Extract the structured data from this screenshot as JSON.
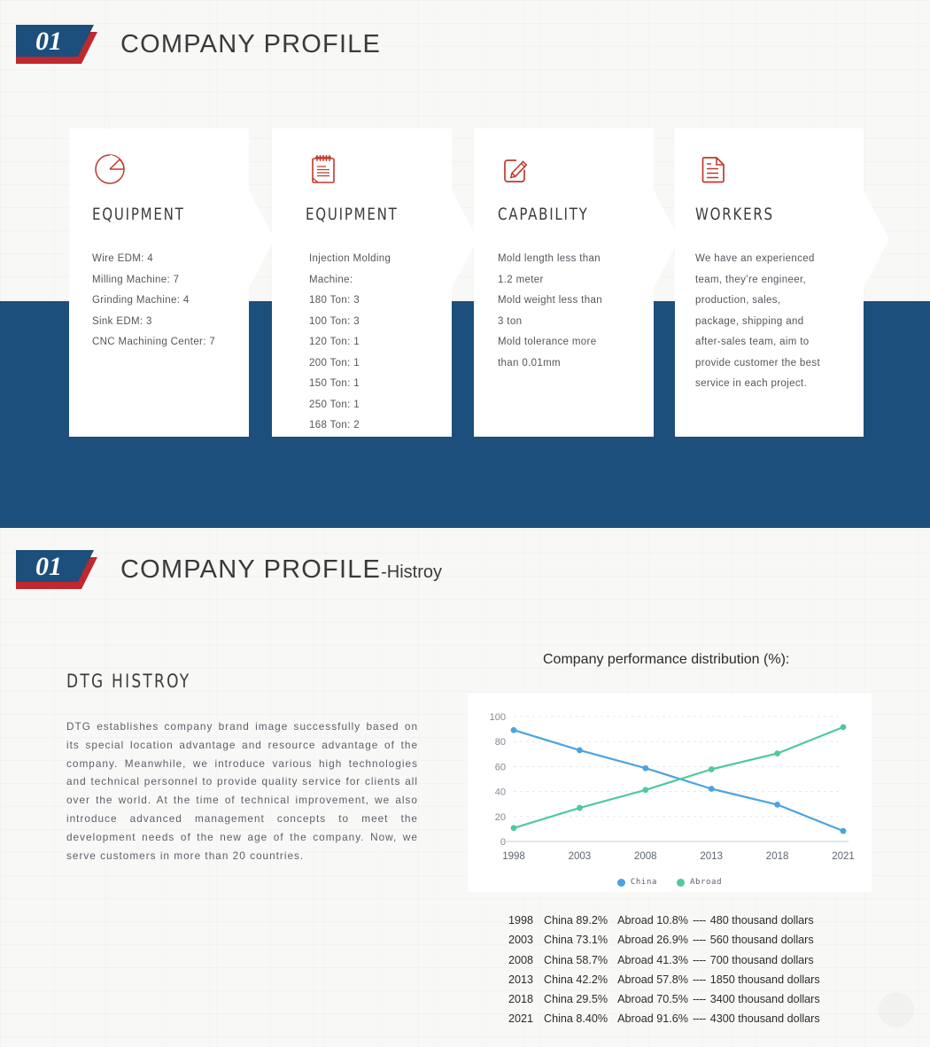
{
  "theme": {
    "blue": "#1d4f7c",
    "red": "#c0282d",
    "icon_red": "#c0392f",
    "china_color": "#4ba3e3",
    "abroad_color": "#4fca9a",
    "page_bg": "#f7f7f6"
  },
  "section1": {
    "badge": "01",
    "title": "COMPANY PROFILE"
  },
  "section2": {
    "badge": "01",
    "title": "COMPANY PROFILE",
    "subtitle": "-Histroy"
  },
  "cards": [
    {
      "icon": "pie-chart-icon",
      "title": "EQUIPMENT",
      "lines": [
        "Wire EDM: 4",
        "Milling Machine: 7",
        "Grinding Machine: 4",
        "Sink EDM: 3",
        "CNC Machining Center: 7"
      ]
    },
    {
      "icon": "notepad-icon",
      "title": "EQUIPMENT",
      "lines": [
        "Injection Molding",
        "Machine:",
        "180 Ton: 3",
        "100 Ton: 3",
        "120 Ton: 1",
        "200 Ton: 1",
        "150 Ton: 1",
        "250 Ton: 1",
        "168 Ton: 2"
      ]
    },
    {
      "icon": "edit-pencil-icon",
      "title": "CAPABILITY",
      "lines": [
        "Mold length less than",
        "1.2 meter",
        "Mold weight less than",
        "3 ton",
        "Mold tolerance more",
        "than 0.01mm"
      ]
    },
    {
      "icon": "document-icon",
      "title": "WORKERS",
      "lines": [
        "We have an experienced",
        "team, they’re engineer,",
        "production, sales,",
        "package, shipping and",
        "after-sales team, aim to",
        "provide customer the best",
        "service in each project."
      ]
    }
  ],
  "history": {
    "heading": "DTG HISTROY",
    "paragraph": "DTG establishes company brand image successfully based on its special location advantage and resource advantage of the company. Meanwhile, we introduce various high technologies and technical personnel to provide quality service for clients all over the world. At the time of technical improvement, we also introduce advanced management concepts to meet the development needs of the new age of the company. Now, we serve customers in more than 20 countries."
  },
  "chart_data": {
    "type": "line",
    "title": "Company performance distribution (%):",
    "xlabel": "",
    "ylabel": "",
    "categories": [
      "1998",
      "2003",
      "2008",
      "2013",
      "2018",
      "2021"
    ],
    "ylim": [
      0,
      100
    ],
    "yticks": [
      0,
      20,
      40,
      60,
      80,
      100
    ],
    "grid": true,
    "legend_position": "bottom",
    "series": [
      {
        "name": "China",
        "color": "#4ba3e3",
        "values": [
          89.2,
          73.1,
          58.7,
          42.2,
          29.5,
          8.4
        ]
      },
      {
        "name": "Abroad",
        "color": "#4fca9a",
        "values": [
          10.8,
          26.9,
          41.3,
          57.8,
          70.5,
          91.6
        ]
      }
    ]
  },
  "performance_rows": [
    {
      "year": "1998",
      "china": "China 89.2%",
      "abroad": "Abroad 10.8%",
      "dash": "----",
      "amount": "480 thousand dollars"
    },
    {
      "year": "2003",
      "china": "China 73.1%",
      "abroad": "Abroad 26.9%",
      "dash": "----",
      "amount": "560 thousand dollars"
    },
    {
      "year": "2008",
      "china": "China 58.7%",
      "abroad": "Abroad 41.3%",
      "dash": "----",
      "amount": "700 thousand dollars"
    },
    {
      "year": "2013",
      "china": "China 42.2%",
      "abroad": "Abroad 57.8%",
      "dash": "----",
      "amount": "1850 thousand dollars"
    },
    {
      "year": "2018",
      "china": "China 29.5%",
      "abroad": "Abroad 70.5%",
      "dash": "----",
      "amount": "3400 thousand dollars"
    },
    {
      "year": "2021",
      "china": "China 8.40%",
      "abroad": "Abroad 91.6%",
      "dash": "----",
      "amount": "4300 thousand dollars"
    }
  ]
}
